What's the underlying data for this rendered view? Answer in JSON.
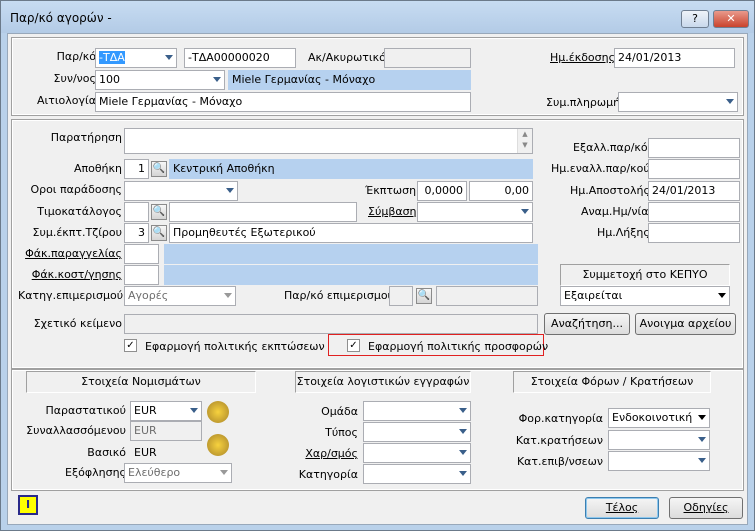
{
  "window": {
    "title": "Παρ/κό αγορών -",
    "help": "?",
    "close": "✕"
  },
  "header": {
    "parko_label": "Παρ/κό",
    "parko_series": "-ΤΔΑ",
    "parko_number": "-ΤΔΑ00000020",
    "akyro_label": "Ακ/Ακυρωτικό",
    "hm_ekdosis_label": "Ημ.έκδοσης",
    "hm_ekdosis_value": "24/01/2013",
    "synal_label": "Συν/νος",
    "synal_code": "100",
    "synal_name": "Miele Γερμανίας - Μόναχο",
    "aitiologia_label": "Αιτιολογία",
    "aitiologia_value": "Miele Γερμανίας - Μόναχο",
    "sym_pliromis_label": "Συμ.πληρωμής"
  },
  "middle": {
    "paratirisi_label": "Παρατήρηση",
    "apothiki_label": "Αποθήκη",
    "apothiki_code": "1",
    "apothiki_name": "Κεντρική Αποθήκη",
    "oroi_label": "Οροι παράδοσης",
    "ekptosi_label": "Έκπτωση",
    "ekptosi_pct": "0,0000",
    "ekptosi_val": "0,00",
    "timokatalogos_label": "Τιμοκατάλογος",
    "symvasi_label": "Σύμβαση",
    "sym_ekpt_label": "Συμ.έκπτ.Τζίρου",
    "sym_ekpt_code": "3",
    "sym_ekpt_name": "Προμηθευτές Εξωτερικού",
    "fak_parag_label": "Φάκ.παραγγελίας",
    "fak_kost_label": "Φάκ.κοστ/γησης",
    "katig_label": "Κατηγ.επιμερισμού",
    "katig_value": "Αγορές",
    "parko_epim_label": "Παρ/κό επιμερισμού",
    "sxetiko_label": "Σχετικό κείμενο",
    "eksall_label": "Εξαλλ.παρ/κό",
    "hm_eksall_label": "Ημ.εναλλ.παρ/κού",
    "hm_apostolis_label": "Ημ.Αποστολής",
    "hm_apostolis_value": "24/01/2013",
    "anam_label": "Αναμ.Ημ/νία",
    "hm_lixis_label": "Ημ.Λήξης",
    "kenypo_label": "Συμμετοχή στο ΚΕΠΥΟ",
    "kenypo_value": "Εξαιρείται",
    "search_btn": "Αναζήτηση...",
    "open_file_btn": "Ανοιγμα αρχείου",
    "chk1_label": "Εφαρμογή πολιτικής εκπτώσεων",
    "chk2_label": "Εφαρμογή πολιτικής προσφορών"
  },
  "currency": {
    "header": "Στοιχεία Νομισμάτων",
    "parast_label": "Παραστατικού",
    "parast_value": "EUR",
    "synal_label": "Συναλλασσόμενου",
    "synal_value": "EUR",
    "vasiko_label": "Βασικό",
    "vasiko_value": "EUR",
    "eksof_label": "Εξόφλησης",
    "eksof_value": "Ελεύθερο"
  },
  "accounting": {
    "header": "Στοιχεία λογιστικών εγγραφών",
    "omada_label": "Ομάδα",
    "typos_label": "Τύπος",
    "xarsmos_label": "Χαρ/σμός",
    "katigoria_label": "Κατηγορία"
  },
  "taxes": {
    "header": "Στοιχεία Φόρων / Κρατήσεων",
    "for_label": "Φορ.κατηγορία",
    "for_value": "Ενδοκοινοτική",
    "krat_label": "Κατ.κρατήσεων",
    "epiv_label": "Κατ.επιβ/νσεων"
  },
  "footer": {
    "ok": "Τέλος",
    "help": "Οδηγίες",
    "info_icon": "I"
  },
  "colors": {
    "title_bg": "#b9d1ea",
    "highlight": "#b6d1ef",
    "red_box": "#e02020"
  }
}
